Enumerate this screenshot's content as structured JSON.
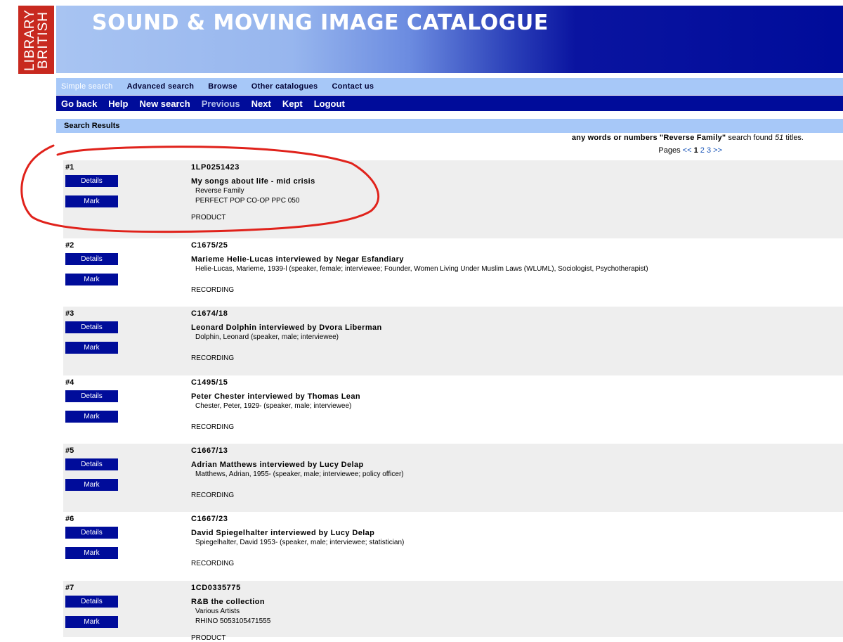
{
  "logo": {
    "line1": "LIBRARY",
    "line2": "BRITISH"
  },
  "banner": {
    "title": "SOUND & MOVING IMAGE CATALOGUE"
  },
  "nav_primary": [
    {
      "label": "Simple search",
      "active": true
    },
    {
      "label": "Advanced search"
    },
    {
      "label": "Browse"
    },
    {
      "label": "Other catalogues"
    },
    {
      "label": "Contact us"
    }
  ],
  "nav_secondary": [
    {
      "label": "Go back"
    },
    {
      "label": "Help"
    },
    {
      "label": "New search"
    },
    {
      "label": "Previous",
      "dim": true
    },
    {
      "label": "Next"
    },
    {
      "label": "Kept"
    },
    {
      "label": "Logout"
    }
  ],
  "section_title": "Search Results",
  "summary": {
    "prefix": "any words or numbers",
    "query": "\"Reverse Family\"",
    "middle": "search found",
    "count": "51",
    "suffix": "titles."
  },
  "pagination": {
    "label": "Pages",
    "prev": "<<",
    "current": "1",
    "pages": [
      "2",
      "3"
    ],
    "next": ">>"
  },
  "buttons": {
    "details": "Details",
    "mark": "Mark"
  },
  "results": [
    {
      "num": "#1",
      "shelfmark": "1LP0251423",
      "title": "My songs about life - mid crisis",
      "lines": [
        "Reverse Family",
        "PERFECT POP CO-OP PPC 050"
      ],
      "type": "PRODUCT"
    },
    {
      "num": "#2",
      "shelfmark": "C1675/25",
      "title": "Marieme Helie-Lucas interviewed by Negar Esfandiary",
      "lines": [
        "Helie-Lucas, Marieme, 1939-l (speaker, female; interviewee; Founder, Women Living Under Muslim Laws (WLUML), Sociologist, Psychotherapist)"
      ],
      "type": "RECORDING"
    },
    {
      "num": "#3",
      "shelfmark": "C1674/18",
      "title": "Leonard Dolphin interviewed by Dvora Liberman",
      "lines": [
        "Dolphin, Leonard (speaker, male; interviewee)"
      ],
      "type": "RECORDING"
    },
    {
      "num": "#4",
      "shelfmark": "C1495/15",
      "title": "Peter Chester interviewed by Thomas Lean",
      "lines": [
        "Chester, Peter, 1929- (speaker, male; interviewee)"
      ],
      "type": "RECORDING"
    },
    {
      "num": "#5",
      "shelfmark": "C1667/13",
      "title": "Adrian Matthews interviewed by Lucy Delap",
      "lines": [
        "Matthews, Adrian, 1955- (speaker, male; interviewee; policy officer)"
      ],
      "type": "RECORDING"
    },
    {
      "num": "#6",
      "shelfmark": "C1667/23",
      "title": "David Spiegelhalter interviewed by Lucy Delap",
      "lines": [
        "Spiegelhalter, David 1953- (speaker, male; interviewee; statistician)"
      ],
      "type": "RECORDING"
    },
    {
      "num": "#7",
      "shelfmark": "1CD0335775",
      "title": "R&B the collection",
      "lines": [
        "Various Artists",
        "RHINO 5053105471555"
      ],
      "type": "PRODUCT"
    }
  ],
  "annotation_color": "#e0221b"
}
